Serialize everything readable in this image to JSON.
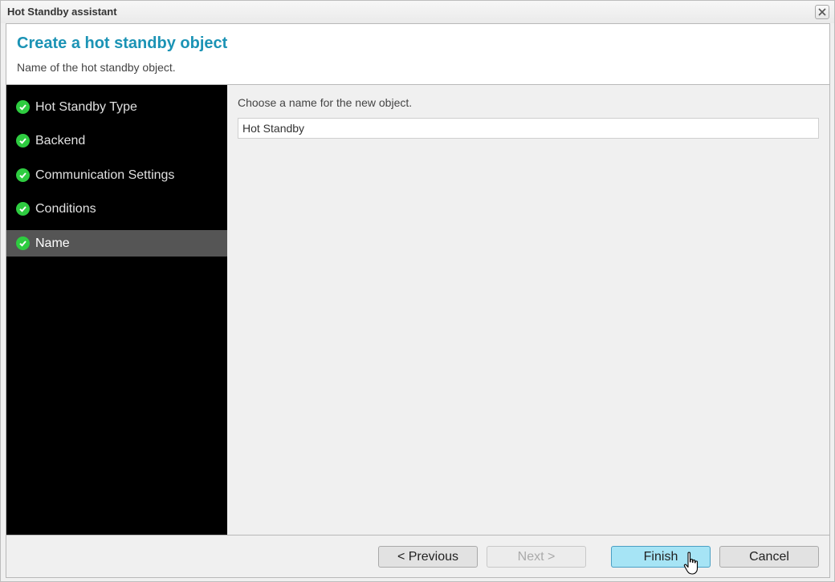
{
  "window": {
    "title": "Hot Standby assistant",
    "close_icon": "close-icon"
  },
  "header": {
    "title": "Create a hot standby object",
    "subtitle": "Name of the hot standby object."
  },
  "steps": [
    {
      "label": "Hot Standby Type",
      "status": "complete",
      "icon": "check-circle-icon"
    },
    {
      "label": "Backend",
      "status": "complete",
      "icon": "check-circle-icon"
    },
    {
      "label": "Communication Settings",
      "status": "complete",
      "icon": "check-circle-icon"
    },
    {
      "label": "Conditions",
      "status": "complete",
      "icon": "check-circle-icon"
    },
    {
      "label": "Name",
      "status": "complete",
      "active": true,
      "icon": "check-circle-icon"
    }
  ],
  "main": {
    "prompt": "Choose a name for the new object.",
    "name_value": "Hot Standby"
  },
  "footer": {
    "previous_label": "< Previous",
    "next_label": "Next >",
    "finish_label": "Finish",
    "cancel_label": "Cancel"
  },
  "colors": {
    "accent": "#1b93b5",
    "check": "#2ecc40",
    "primary_button": "#a6e4f5",
    "active_step": "#555555"
  }
}
